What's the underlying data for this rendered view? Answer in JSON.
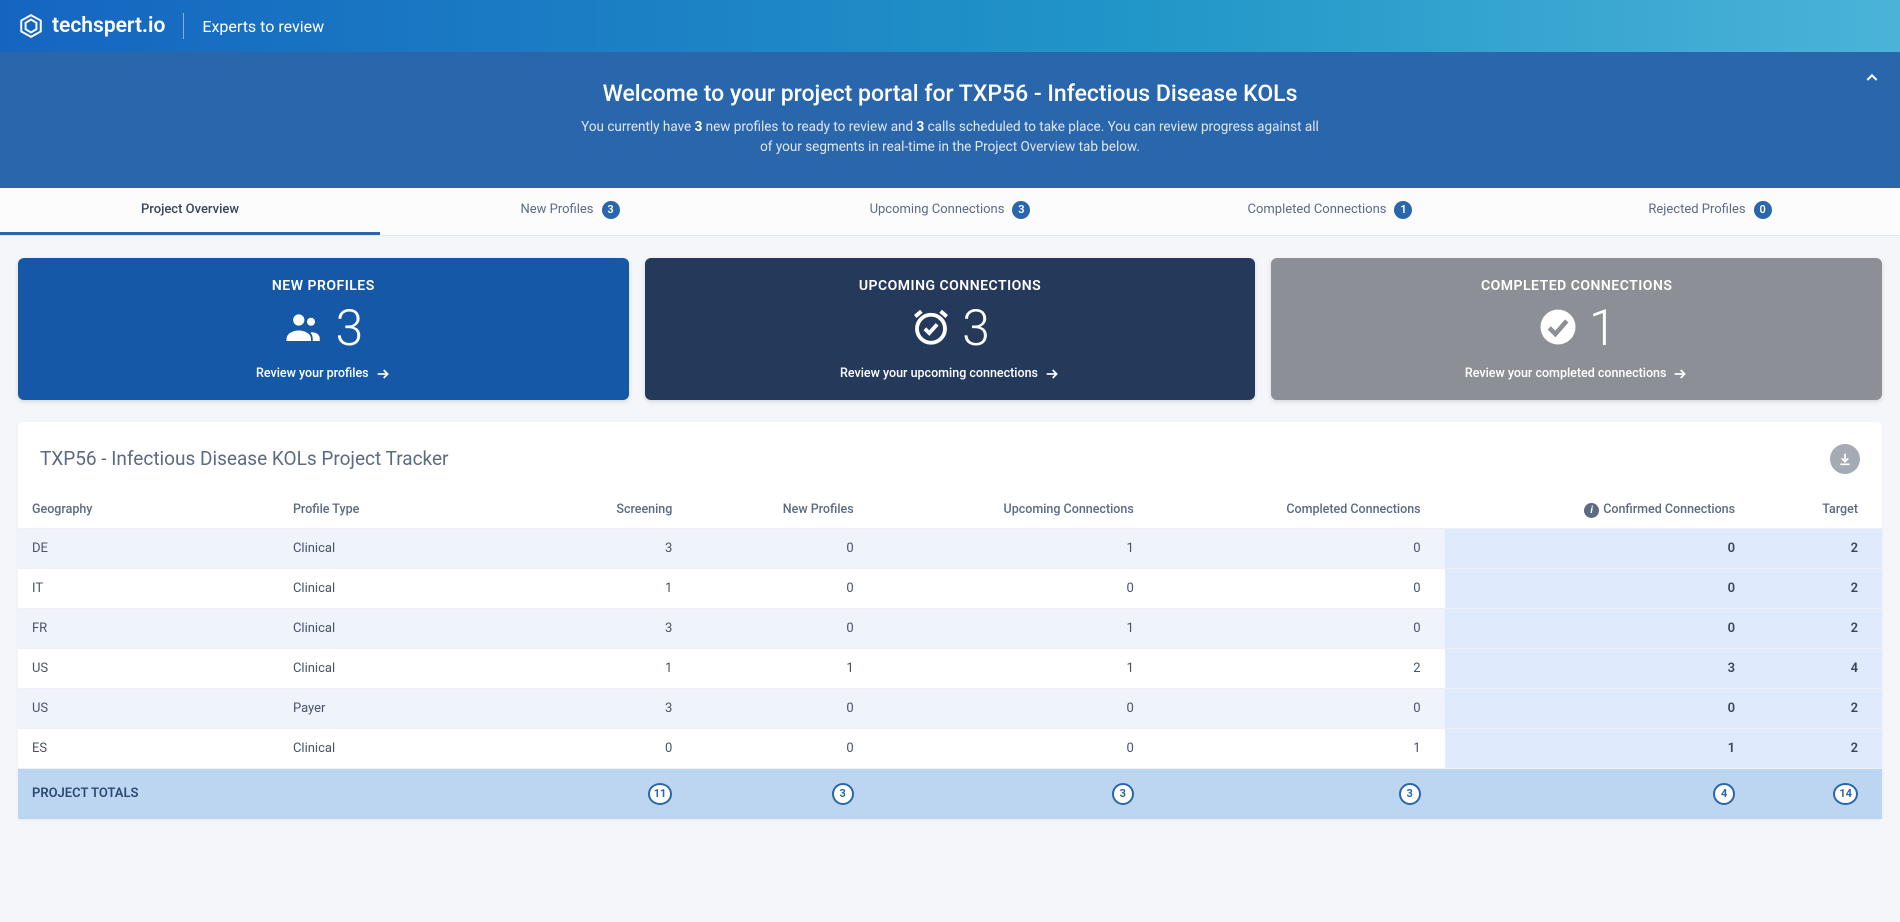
{
  "header": {
    "brand": "techspert.io",
    "subtitle": "Experts to review"
  },
  "banner": {
    "title": "Welcome to your project portal for TXP56 - Infectious Disease KOLs",
    "text_pre": "You currently have ",
    "new_profiles_count": "3",
    "text_mid1": " new profiles to ready to review and ",
    "calls_count": "3",
    "text_mid2": " calls scheduled to take place. You can review progress against all of your segments in real-time in the Project Overview tab below."
  },
  "tabs": [
    {
      "label": "Project Overview",
      "badge": null,
      "active": true
    },
    {
      "label": "New Profiles",
      "badge": "3",
      "active": false
    },
    {
      "label": "Upcoming Connections",
      "badge": "3",
      "active": false
    },
    {
      "label": "Completed Connections",
      "badge": "1",
      "active": false
    },
    {
      "label": "Rejected Profiles",
      "badge": "0",
      "active": false
    }
  ],
  "cards": {
    "new_profiles": {
      "heading": "NEW PROFILES",
      "count": "3",
      "link": "Review your profiles"
    },
    "upcoming": {
      "heading": "UPCOMING CONNECTIONS",
      "count": "3",
      "link": "Review your upcoming connections"
    },
    "completed": {
      "heading": "COMPLETED CONNECTIONS",
      "count": "1",
      "link": "Review your completed connections"
    }
  },
  "tracker": {
    "title": "TXP56 - Infectious Disease KOLs Project Tracker",
    "columns": {
      "geography": "Geography",
      "profile_type": "Profile Type",
      "screening": "Screening",
      "new_profiles": "New Profiles",
      "upcoming": "Upcoming Connections",
      "completed": "Completed Connections",
      "confirmed": "Confirmed Connections",
      "target": "Target"
    },
    "rows": [
      {
        "geography": "DE",
        "profile_type": "Clinical",
        "screening": "3",
        "new_profiles": "0",
        "upcoming": "1",
        "completed": "0",
        "confirmed": "0",
        "target": "2"
      },
      {
        "geography": "IT",
        "profile_type": "Clinical",
        "screening": "1",
        "new_profiles": "0",
        "upcoming": "0",
        "completed": "0",
        "confirmed": "0",
        "target": "2"
      },
      {
        "geography": "FR",
        "profile_type": "Clinical",
        "screening": "3",
        "new_profiles": "0",
        "upcoming": "1",
        "completed": "0",
        "confirmed": "0",
        "target": "2"
      },
      {
        "geography": "US",
        "profile_type": "Clinical",
        "screening": "1",
        "new_profiles": "1",
        "upcoming": "1",
        "completed": "2",
        "confirmed": "3",
        "target": "4"
      },
      {
        "geography": "US",
        "profile_type": "Payer",
        "screening": "3",
        "new_profiles": "0",
        "upcoming": "0",
        "completed": "0",
        "confirmed": "0",
        "target": "2"
      },
      {
        "geography": "ES",
        "profile_type": "Clinical",
        "screening": "0",
        "new_profiles": "0",
        "upcoming": "0",
        "completed": "1",
        "confirmed": "1",
        "target": "2"
      }
    ],
    "totals": {
      "label": "PROJECT TOTALS",
      "screening": "11",
      "new_profiles": "3",
      "upcoming": "3",
      "completed": "3",
      "confirmed": "4",
      "target": "14"
    }
  }
}
